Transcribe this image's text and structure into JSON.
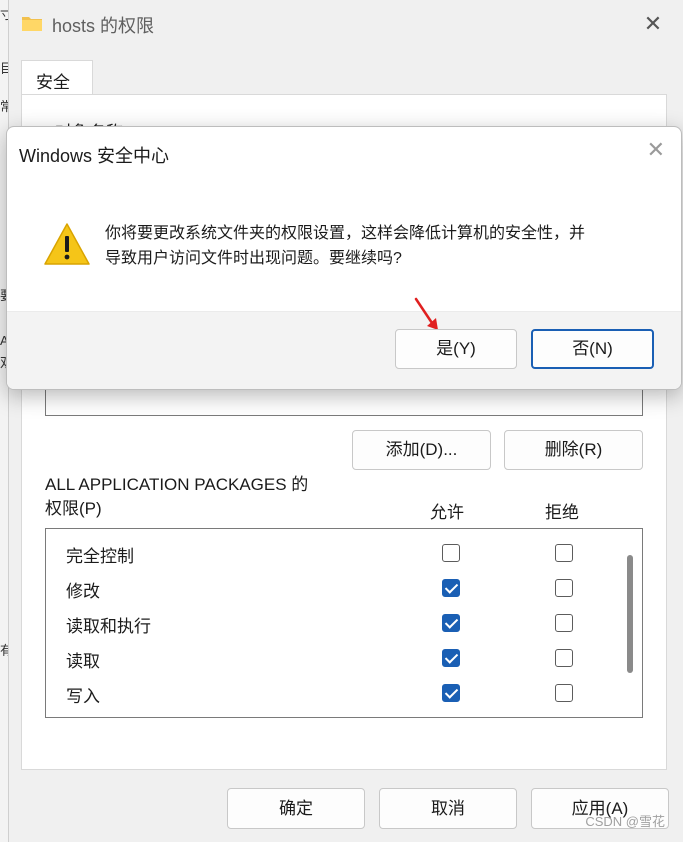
{
  "window": {
    "title": "hosts 的权限",
    "close_glyph": "✕",
    "tab": "安全",
    "object_name_label": "对象名称:"
  },
  "background_strip": [
    "寸",
    "目",
    "常",
    "要",
    "A",
    "双",
    "有"
  ],
  "group_buttons": {
    "add": "添加(D)...",
    "remove": "删除(R)"
  },
  "permissions": {
    "title_line1": "ALL APPLICATION PACKAGES 的",
    "title_line2": "权限(P)",
    "allow_header": "允许",
    "deny_header": "拒绝",
    "rows": [
      {
        "name": "完全控制",
        "allow": false,
        "deny": false
      },
      {
        "name": "修改",
        "allow": true,
        "deny": false
      },
      {
        "name": "读取和执行",
        "allow": true,
        "deny": false
      },
      {
        "name": "读取",
        "allow": true,
        "deny": false
      },
      {
        "name": "写入",
        "allow": true,
        "deny": false
      }
    ]
  },
  "footer_buttons": {
    "ok": "确定",
    "cancel": "取消",
    "apply": "应用(A)"
  },
  "dialog": {
    "title": "Windows 安全中心",
    "close_glyph": "✕",
    "message_line1": "你将要更改系统文件夹的权限设置，这样会降低计算机的安全性，并",
    "message_line2": "导致用户访问文件时出现问题。要继续吗?",
    "yes_label": "是(Y)",
    "no_label": "否(N)"
  },
  "watermark": "CSDN @雪花",
  "colors": {
    "accent": "#1a5fb4",
    "warning_yellow": "#f5c518",
    "arrow_red": "#e02020"
  },
  "icons": {
    "folder": "folder-icon",
    "warning": "warning-icon",
    "arrow": "red-arrow-icon"
  }
}
